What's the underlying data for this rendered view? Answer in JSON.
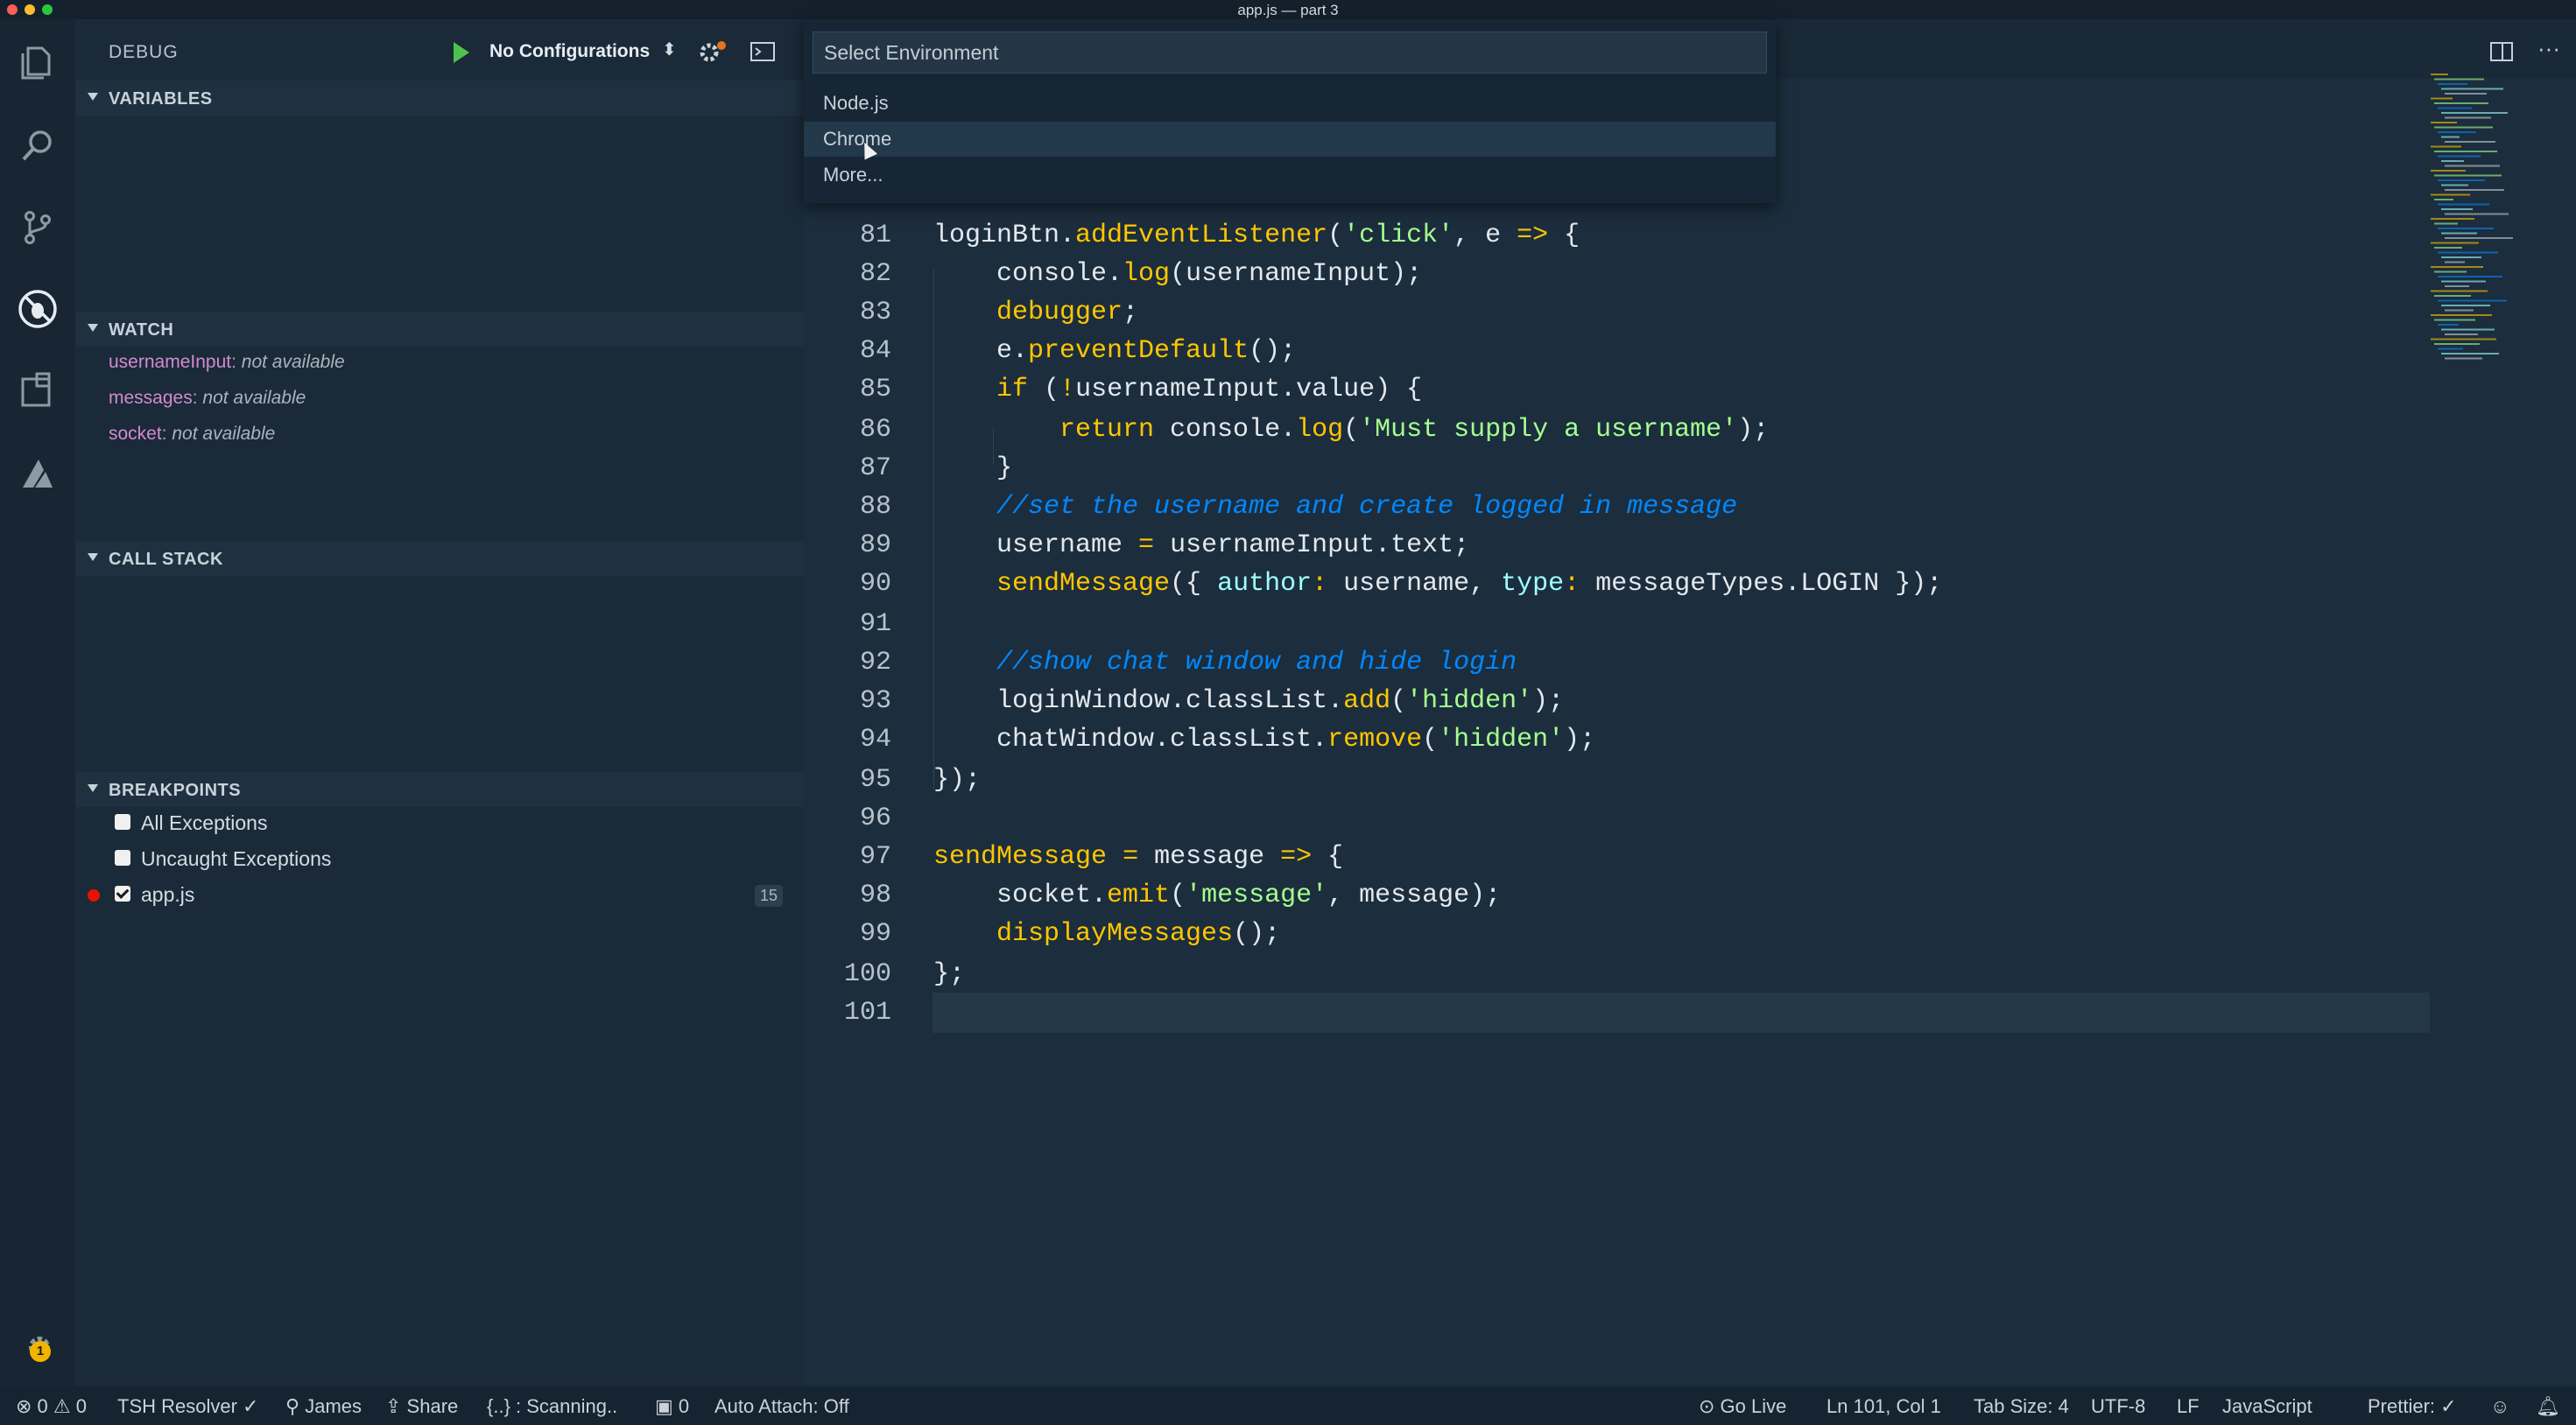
{
  "window": {
    "title": "app.js — part 3"
  },
  "sidebar": {
    "title": "DEBUG",
    "configuration": "No Configurations",
    "sections": {
      "variables": "VARIABLES",
      "watch": "WATCH",
      "call_stack": "CALL STACK",
      "breakpoints": "BREAKPOINTS"
    },
    "watch_items": [
      {
        "name": "usernameInput:",
        "value": "not available"
      },
      {
        "name": "messages:",
        "value": "not available"
      },
      {
        "name": "socket:",
        "value": "not available"
      }
    ],
    "breakpoints": [
      {
        "label": "All Exceptions",
        "checked": false
      },
      {
        "label": "Uncaught Exceptions",
        "checked": false
      },
      {
        "label": "app.js",
        "checked": true,
        "count": "15"
      }
    ]
  },
  "quick_pick": {
    "placeholder": "Select Environment",
    "items": [
      "Node.js",
      "Chrome",
      "More..."
    ],
    "selected": "Chrome"
  },
  "editor": {
    "line_numbers": [
      "81",
      "82",
      "83",
      "84",
      "85",
      "86",
      "87",
      "88",
      "89",
      "90",
      "91",
      "92",
      "93",
      "94",
      "95",
      "96",
      "97",
      "98",
      "99",
      "100",
      "101"
    ]
  },
  "statusbar": {
    "errors": "0",
    "warnings": "0",
    "tsh": "TSH Resolver ✓",
    "user": "James",
    "share": "Share",
    "scanning": "{..} : Scanning..",
    "live_count": "0",
    "auto_attach": "Auto Attach: Off",
    "go_live": "Go Live",
    "position": "Ln 101, Col 1",
    "tab_size": "Tab Size: 4",
    "encoding": "UTF-8",
    "eol": "LF",
    "language": "JavaScript",
    "prettier": "Prettier: ✓",
    "notification_badge": "1"
  },
  "colors": {
    "keyword": "#ffc600",
    "string": "#a5ff90",
    "comment": "#0088ff",
    "property": "#9effff",
    "watch_name": "#d38ad1",
    "breakpoint": "#e51400"
  }
}
